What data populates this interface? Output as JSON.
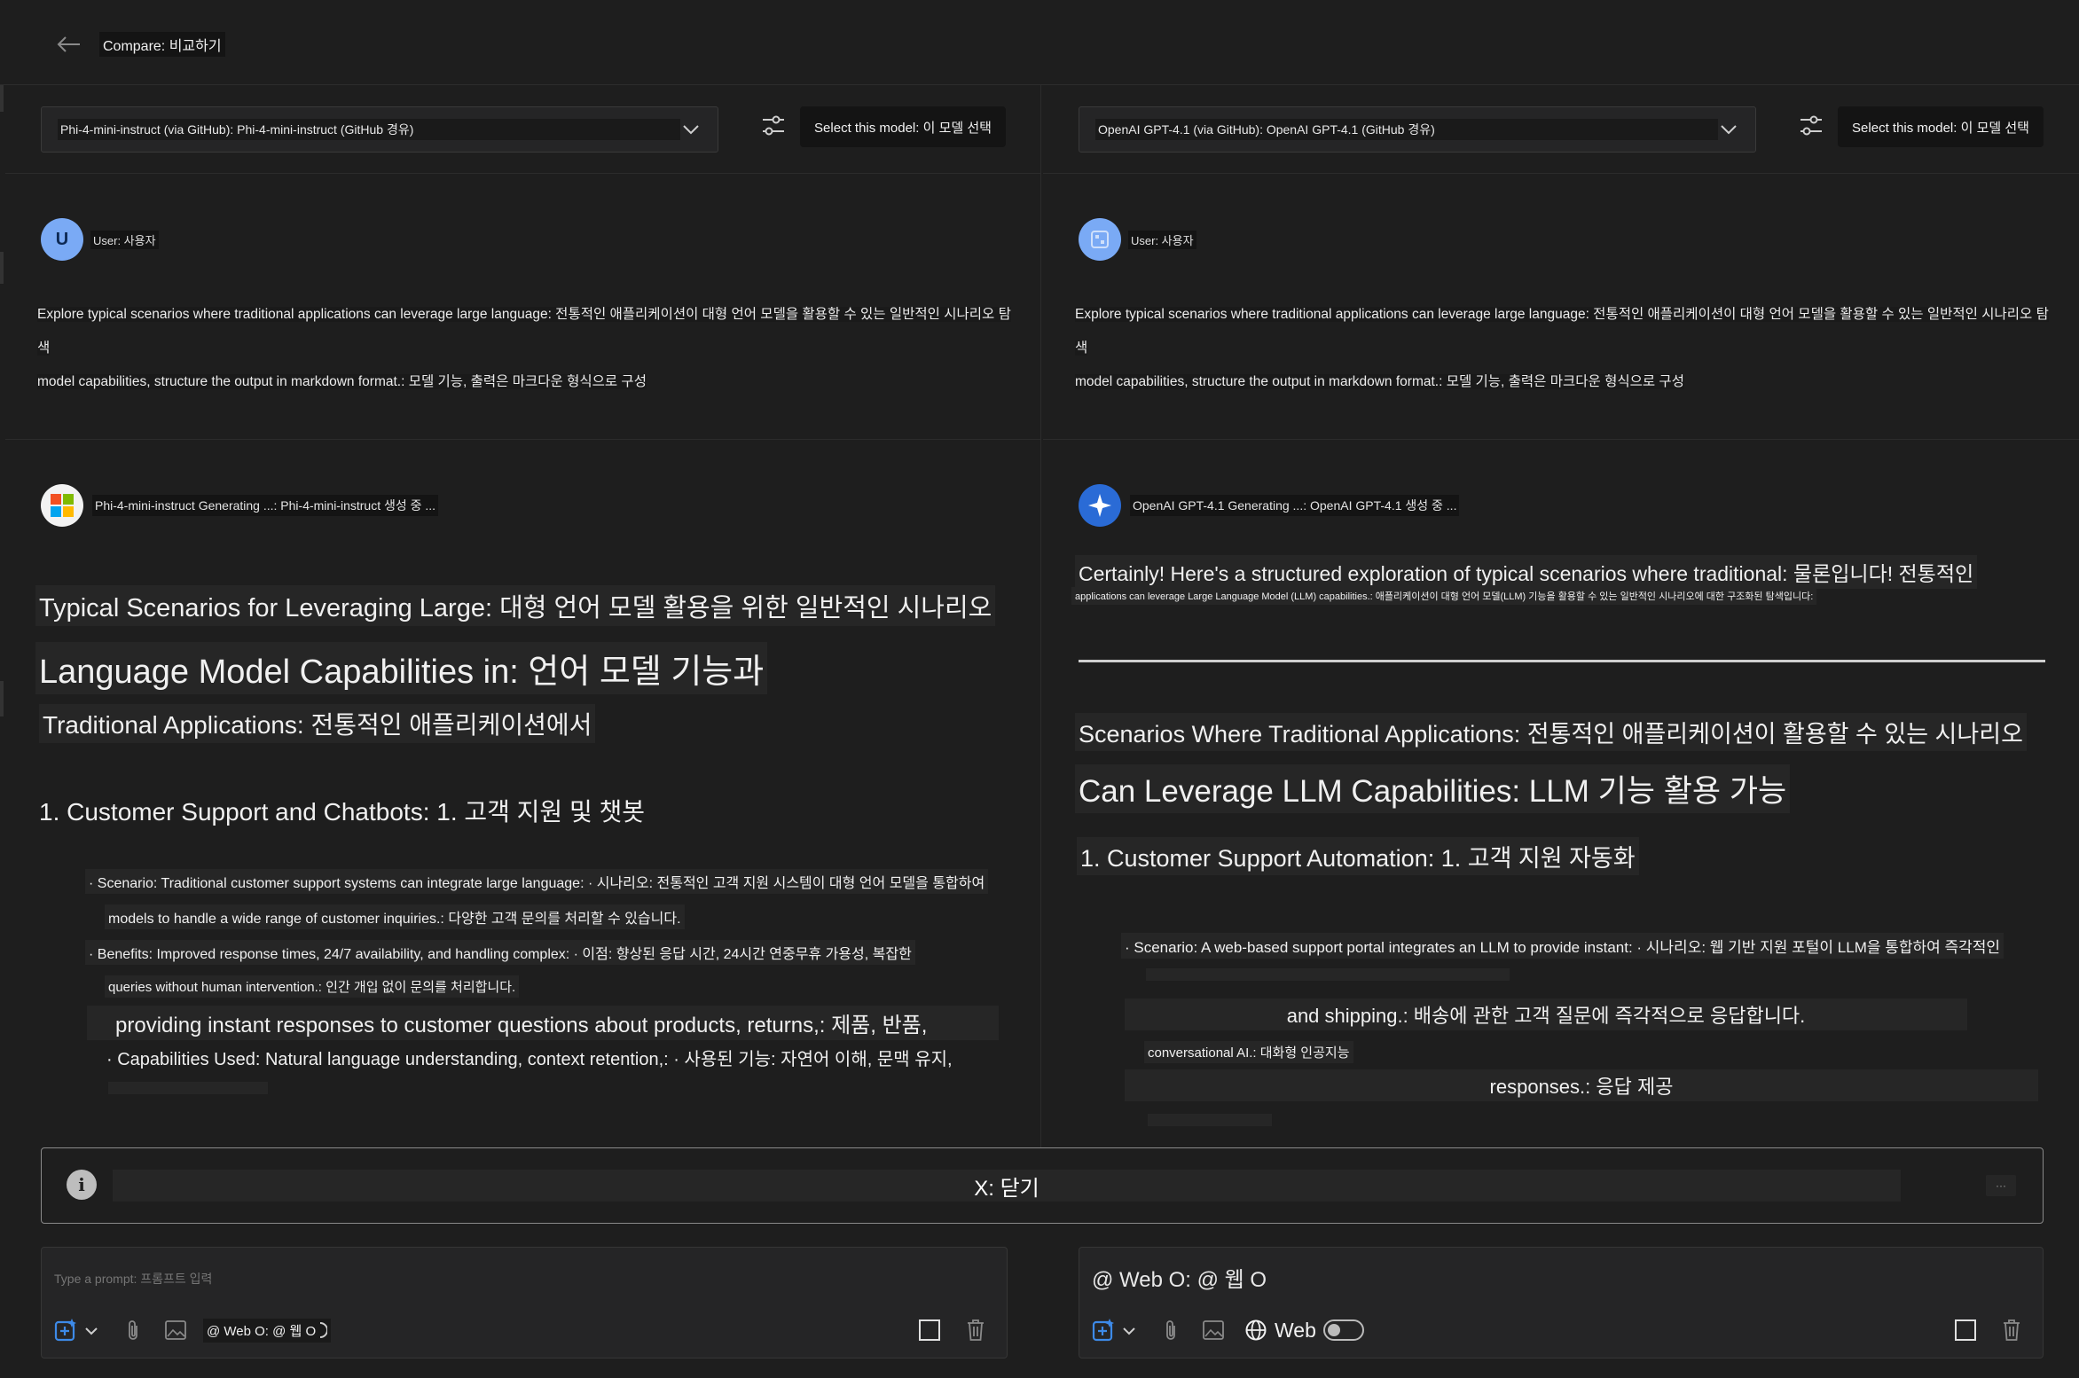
{
  "header": {
    "title": "Compare: 비교하기"
  },
  "left": {
    "model_select": "Phi-4-mini-instruct (via GitHub): Phi-4-mini-instruct (GitHub 경유)",
    "select_button": "Select this model: 이 모델 선택",
    "user_avatar_letter": "U",
    "user_label": "User: 사용자",
    "prompt_line1": "Explore typical scenarios where traditional applications can leverage large language: 전통적인 애플리케이션이 대형 언어 모델을 활용할 수 있는 일반적인 시나리오 탐색",
    "prompt_line2": "model capabilities, structure the output in markdown format.: 모델 기능, 출력은 마크다운 형식으로 구성",
    "generating": "Phi-4-mini-instruct Generating ...: Phi-4-mini-instruct 생성 중 ...",
    "h_line1": "Typical Scenarios for Leveraging Large: 대형 언어 모델 활용을 위한 일반적인 시나리오",
    "h_line2": "Language Model Capabilities in: 언어 모델 기능과",
    "h_line3": "Traditional Applications: 전통적인 애플리케이션에서",
    "h_section": "1. Customer Support and Chatbots: 1. 고객 지원 및 챗봇",
    "b1_line1": "· Scenario: Traditional customer support systems can integrate large language: · 시나리오: 전통적인 고객 지원 시스템이 대형 언어 모델을 통합하여",
    "b1_line2": "models to handle a wide range of customer inquiries.: 다양한 고객 문의를 처리할 수 있습니다.",
    "b2_line1": "· Benefits: Improved response times, 24/7 availability, and handling complex: · 이점: 향상된 응답 시간, 24시간 연중무휴 가용성, 복잡한",
    "b2_line2": "queries without human intervention.: 인간 개입 없이 문의를 처리합니다.",
    "b3_line": "providing instant responses to customer questions about products, returns,: 제품, 반품,",
    "b4_line": "· Capabilities Used: Natural language understanding, context retention,: · 사용된 기능: 자연어 이해, 문맥 유지,"
  },
  "right": {
    "model_select": "OpenAI GPT-4.1 (via GitHub): OpenAI GPT-4.1 (GitHub 경유)",
    "select_button": "Select this model: 이 모델 선택",
    "user_label": "User: 사용자",
    "prompt_line1": "Explore typical scenarios where traditional applications can leverage large language: 전통적인 애플리케이션이 대형 언어 모델을 활용할 수 있는 일반적인 시나리오 탐색",
    "prompt_line2": "model capabilities, structure the output in markdown format.: 모델 기능, 출력은 마크다운 형식으로 구성",
    "generating": "OpenAI GPT-4.1 Generating ...: OpenAI GPT-4.1 생성 중 ...",
    "intro_line1": "Certainly! Here's a structured exploration of typical scenarios where traditional: 물론입니다! 전통적인",
    "intro_line2": "applications can leverage Large Language Model (LLM) capabilities.: 애플리케이션이 대형 언어 모델(LLM) 기능을 활용할 수 있는 일반적인 시나리오에 대한 구조화된 탐색입니다:",
    "h_line1": "Scenarios Where Traditional Applications: 전통적인 애플리케이션이 활용할 수 있는 시나리오",
    "h_line2": "Can Leverage LLM Capabilities: LLM 기능 활용 가능",
    "h_section": "1. Customer Support Automation: 1. 고객 지원 자동화",
    "b1_line": "· Scenario: A web-based support portal integrates an LLM to provide instant: · 시나리오: 웹 기반 지원 포털이 LLM을 통합하여 즉각적인",
    "b2_line": "and shipping.: 배송에 관한 고객 질문에 즉각적으로 응답합니다.",
    "b3_line": "conversational AI.: 대화형 인공지능",
    "b4_line": "responses.: 응답 제공"
  },
  "banner": {
    "text": "X: 닫기"
  },
  "composer_left": {
    "placeholder": "Type a prompt: 프롬프트 입력",
    "web_chip": "@ Web O: @ 웹 O"
  },
  "composer_right": {
    "value": "@ Web O: @ 웹 O",
    "web_label": "Web"
  },
  "icons": {
    "back": "arrow-left-icon",
    "chevron": "chevron-down-icon",
    "settings": "sliders-icon",
    "info": "info-icon",
    "attach": "paperclip-icon",
    "image": "image-icon",
    "globe": "globe-icon",
    "stop": "square-icon",
    "delete": "trash-icon"
  },
  "colors": {
    "background": "#1e1e1e",
    "avatar": "#7aaaf5",
    "openai_logo": "#2a6bd6",
    "accent_icon": "#3d8ae8"
  }
}
